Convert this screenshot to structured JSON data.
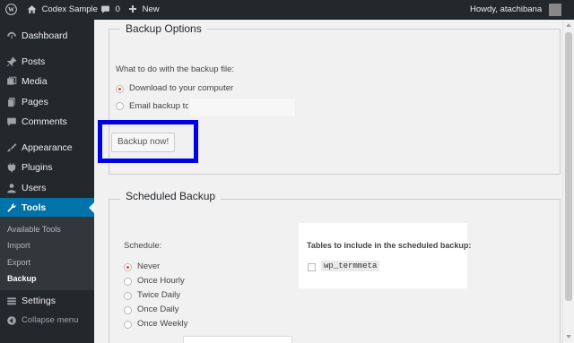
{
  "admin_bar": {
    "site_name": "Codex Sample",
    "comments_count": "0",
    "new_label": "New",
    "greeting": "Howdy, atachibana"
  },
  "sidebar": {
    "items": [
      {
        "label": "Dashboard",
        "icon": "dashboard-icon"
      },
      {
        "label": "Posts",
        "icon": "pin-icon"
      },
      {
        "label": "Media",
        "icon": "media-icon"
      },
      {
        "label": "Pages",
        "icon": "pages-icon"
      },
      {
        "label": "Comments",
        "icon": "comment-icon"
      },
      {
        "label": "Appearance",
        "icon": "brush-icon"
      },
      {
        "label": "Plugins",
        "icon": "plug-icon"
      },
      {
        "label": "Users",
        "icon": "user-icon"
      },
      {
        "label": "Tools",
        "icon": "wrench-icon",
        "current": true
      },
      {
        "label": "Settings",
        "icon": "settings-icon"
      },
      {
        "label": "Collapse menu",
        "icon": "collapse-icon"
      }
    ],
    "submenu": [
      {
        "label": "Available Tools"
      },
      {
        "label": "Import"
      },
      {
        "label": "Export"
      },
      {
        "label": "Backup",
        "current": true
      }
    ]
  },
  "backup_options": {
    "legend": "Backup Options",
    "question": "What to do with the backup file:",
    "option_download": "Download to your computer",
    "option_email": "Email backup to:",
    "selected": "download",
    "button_label": "Backup now!"
  },
  "scheduled_backup": {
    "legend": "Scheduled Backup",
    "schedule_label": "Schedule:",
    "options": [
      "Never",
      "Once Hourly",
      "Twice Daily",
      "Once Daily",
      "Once Weekly"
    ],
    "selected": "Never",
    "tables_label": "Tables to include in the scheduled backup:",
    "tables": [
      {
        "name": "wp_termmeta",
        "checked": false
      }
    ]
  },
  "colors": {
    "admin_bar": "#23282d",
    "menu_current": "#0073aa",
    "highlight_border": "#0000e6",
    "radio_checked": "#d54e21"
  }
}
